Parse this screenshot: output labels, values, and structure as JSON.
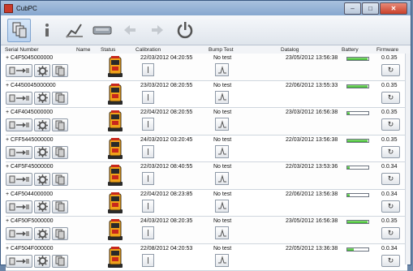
{
  "window": {
    "title": "CubPC",
    "minimize": "–",
    "maximize": "□",
    "close": "✕"
  },
  "toolbar": {
    "buttons": [
      {
        "name": "devices",
        "icon": "devices-icon",
        "active": true
      },
      {
        "name": "info",
        "icon": "info-icon",
        "active": false
      },
      {
        "name": "chart",
        "icon": "chart-icon",
        "active": false
      },
      {
        "name": "tools",
        "icon": "tools-icon",
        "active": false
      },
      {
        "name": "back",
        "icon": "back-arrow-icon",
        "active": false
      },
      {
        "name": "forward",
        "icon": "forward-arrow-icon",
        "active": false
      },
      {
        "name": "power",
        "icon": "power-icon",
        "active": false
      }
    ]
  },
  "columns": {
    "serial": "Serial Number",
    "name": "Name",
    "status": "Status",
    "calibration": "Calibration",
    "bump": "Bump Test",
    "datalog": "Datalog",
    "battery": "Battery",
    "firmware": "Firmware"
  },
  "rows": [
    {
      "serial": "+ C4F5045000000",
      "calibration": "22/03/2012 04:20:55",
      "bump": "No test",
      "datalog": "23/05/2012 13:56:38",
      "battery": 0.95,
      "firmware": "0.0.35"
    },
    {
      "serial": "+ C4450045000000",
      "calibration": "23/03/2012 08:20:55",
      "bump": "No test",
      "datalog": "22/06/2012 13:55:33",
      "battery": 0.95,
      "firmware": "0.0.35"
    },
    {
      "serial": "+ C4F4045000000",
      "calibration": "22/04/2012 08:20:55",
      "bump": "No test",
      "datalog": "23/03/2012 16:56:38",
      "battery": 0.12,
      "firmware": "0.0.35"
    },
    {
      "serial": "+ CFF5445000000",
      "calibration": "24/03/2012 03:20:45",
      "bump": "No test",
      "datalog": "22/03/2012 13:56:38",
      "battery": 0.95,
      "firmware": "0.0.35"
    },
    {
      "serial": "+ C4F5F45000000",
      "calibration": "22/03/2012 08:40:55",
      "bump": "No test",
      "datalog": "22/03/2012 13:53:36",
      "battery": 0.1,
      "firmware": "0.0.34"
    },
    {
      "serial": "+ C4F5044000000",
      "calibration": "22/04/2012 08:23:85",
      "bump": "No test",
      "datalog": "22/06/2012 13:56:38",
      "battery": 0.12,
      "firmware": "0.0.34"
    },
    {
      "serial": "+ C4F50F5000000",
      "calibration": "24/03/2012 08:20:35",
      "bump": "No test",
      "datalog": "23/05/2012 16:56:38",
      "battery": 0.95,
      "firmware": "0.0.35"
    },
    {
      "serial": "+ C4F504F000000",
      "calibration": "22/08/2012 04:20:53",
      "bump": "No test",
      "datalog": "22/05/2012 13:36:38",
      "battery": 0.3,
      "firmware": "0.0.34"
    }
  ],
  "colors": {
    "battery_fill": "#39b52a",
    "device_orange": "#f0a21a",
    "device_red": "#c8271c",
    "device_dark": "#2a2a2a"
  }
}
